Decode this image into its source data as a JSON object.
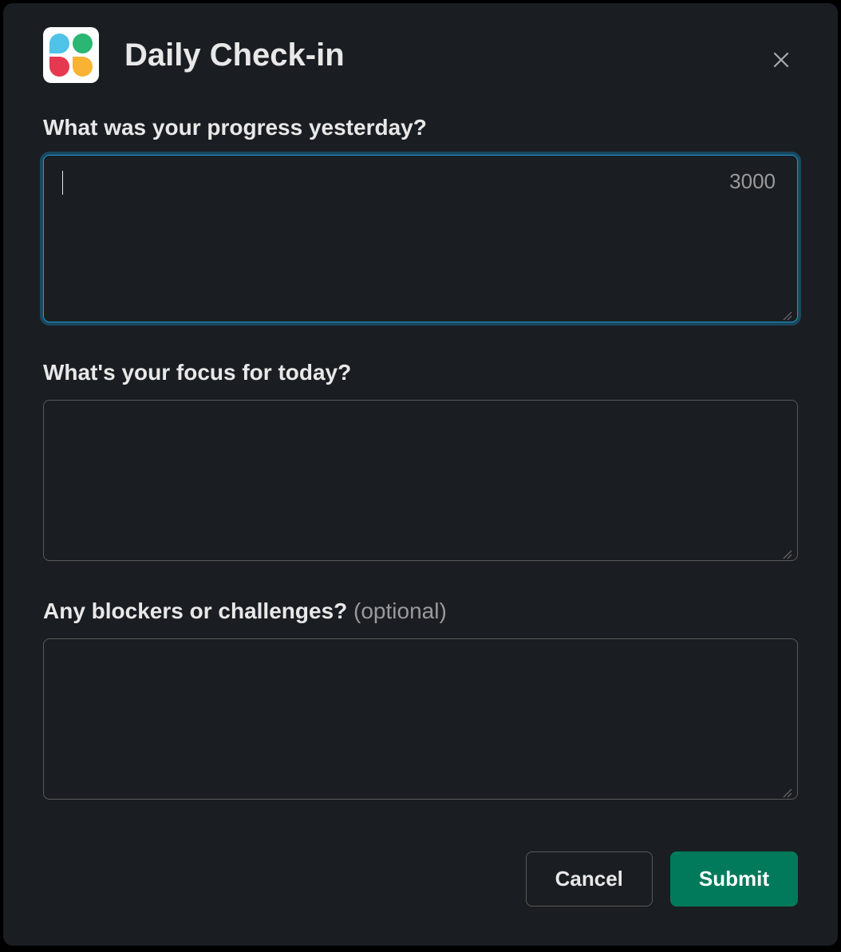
{
  "header": {
    "title": "Daily Check-in"
  },
  "fields": {
    "progress": {
      "label": "What was your progress yesterday?",
      "value": "",
      "char_count": "3000"
    },
    "focus": {
      "label": "What's your focus for today?",
      "value": ""
    },
    "blockers": {
      "label": "Any blockers or challenges?",
      "optional_hint": "(optional)",
      "value": ""
    }
  },
  "footer": {
    "cancel_label": "Cancel",
    "submit_label": "Submit"
  }
}
